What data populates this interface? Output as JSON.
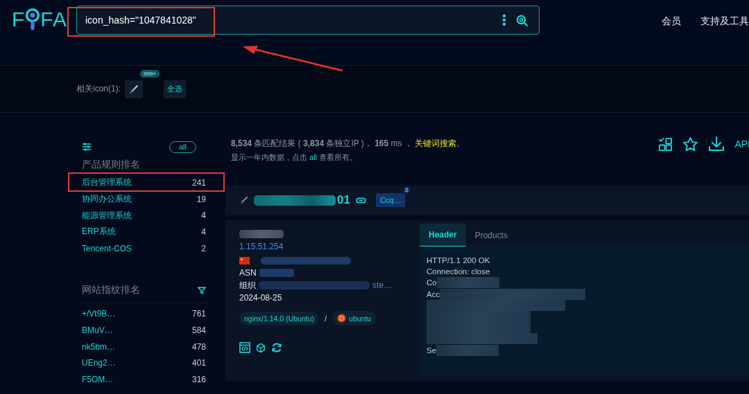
{
  "logo": {
    "before": "F",
    "after": "FA"
  },
  "search": {
    "value": "icon_hash=\"1047841028\""
  },
  "nav": [
    "会员",
    "支持及工具"
  ],
  "icon_filter": {
    "label": "相关icon(1):",
    "badge": "999+",
    "select_all": "全选"
  },
  "sidebar": {
    "all_button": "all",
    "sections": [
      {
        "title": "产品规则排名",
        "items": [
          {
            "name": "后台管理系统",
            "count": "241"
          },
          {
            "name": "协同办公系统",
            "count": "19"
          },
          {
            "name": "能源管理系统",
            "count": "4"
          },
          {
            "name": "ERP系统",
            "count": "4"
          },
          {
            "name": "Tencent-COS",
            "count": "2"
          }
        ]
      },
      {
        "title": "网站指纹排名",
        "items": [
          {
            "name": "+/Vt9B…",
            "count": "761"
          },
          {
            "name": "BMuV…",
            "count": "584"
          },
          {
            "name": "nk5bm…",
            "count": "478"
          },
          {
            "name": "UEng2…",
            "count": "401"
          },
          {
            "name": "F5OM…",
            "count": "316"
          }
        ]
      }
    ]
  },
  "summary": {
    "text": "**8,534** 条匹配结果 ( **3,834** 条独立IP )， **165** ms ，",
    "link": "关键词搜索",
    "end": "。"
  },
  "note": {
    "before": "显示一年内数据，点击",
    "link": "all",
    "after": "查看所有。"
  },
  "toolbar": {
    "api": "API"
  },
  "result": {
    "title_tail": "01",
    "tag": "Ccq…",
    "tag_badge": "2",
    "ip": "1.15.51.254",
    "asn_label": "ASN",
    "org_label": "组织",
    "org_tail": "ste…",
    "date": "2024-08-25",
    "products": [
      {
        "kind": "server",
        "name": "nginx/1.14.0 (Ubuntu)"
      },
      {
        "kind": "os",
        "name": "ubuntu"
      }
    ],
    "separator": "/",
    "tabs": [
      {
        "label": "Header",
        "selected": true
      },
      {
        "label": "Products",
        "selected": false
      }
    ],
    "header_lines": [
      {
        "text": "HTTP/1.1 200 OK",
        "redacted": false
      },
      {
        "text": "Connection: close",
        "redacted": false
      },
      {
        "text": "Co",
        "redacted": true
      },
      {
        "text": "Acc",
        "redacted": true
      },
      {
        "redacted": true
      },
      {
        "redacted": true
      },
      {
        "redacted": true
      },
      {
        "redacted": true
      },
      {
        "text": "Se",
        "redacted": true
      }
    ]
  }
}
